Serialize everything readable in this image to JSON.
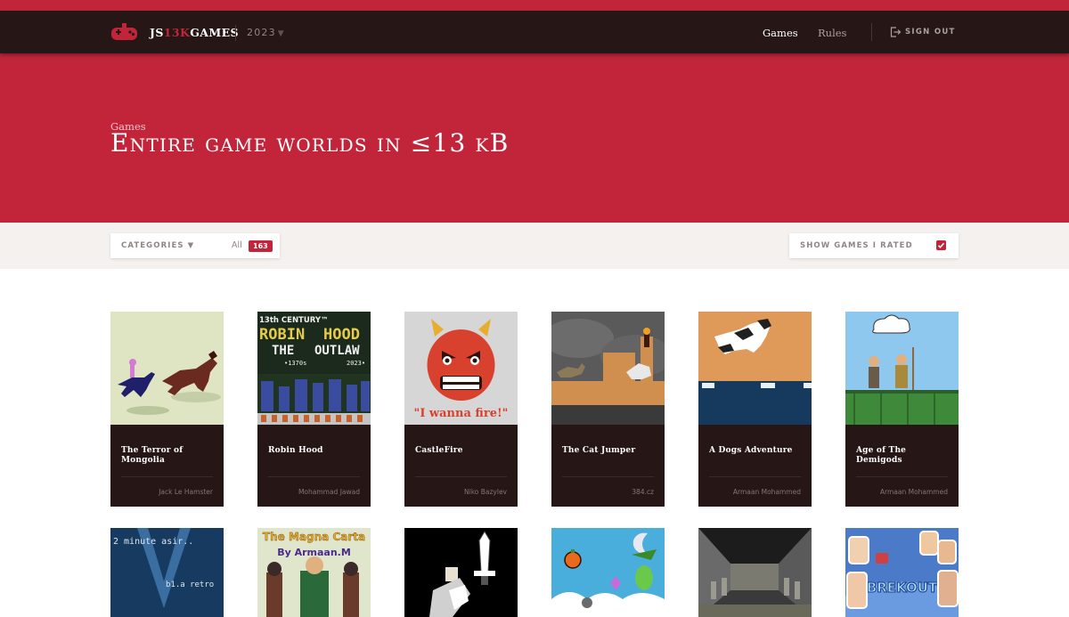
{
  "nav": {
    "brand_prefix": "JS",
    "brand_accent": "13K",
    "brand_suffix": "GAMES",
    "year": "2023",
    "games": "Games",
    "rules": "Rules",
    "sign_out": "SIGN OUT"
  },
  "hero": {
    "kicker": "Games",
    "title": "Entire game worlds in ≤13 kB"
  },
  "filters": {
    "categories_label": "CATEGORIES ▼",
    "all_label": "All",
    "count": "163",
    "rated_label": "SHOW GAMES I RATED",
    "rated_checked": true
  },
  "games": [
    {
      "title": "The Terror of Mongolia",
      "author": "Jack Le Hamster"
    },
    {
      "title": "Robin Hood",
      "author": "Mohammad Jawad"
    },
    {
      "title": "CastleFire",
      "author": "Niko Bazylev"
    },
    {
      "title": "The Cat Jumper",
      "author": "384.cz"
    },
    {
      "title": "A Dogs Adventure",
      "author": "Armaan Mohammed"
    },
    {
      "title": "Age of The Demigods",
      "author": "Armaan Mohammed"
    }
  ],
  "thumb_text": {
    "robin_line1": "13th CENTURY™",
    "robin_line2": "ROBIN",
    "robin_line3": "HOOD",
    "robin_line4": "THE",
    "robin_line5": "OUTLAW",
    "robin_line6": "•1370s",
    "robin_line7": "2023•",
    "castle_caption": "\"I wanna fire!\"",
    "row2_a": "2 minute asir..",
    "row2_a2": "b1.a retro",
    "row2_b1": "The Magna Carta",
    "row2_b2": "By Armaan.M",
    "row2_f": "BREKOUT"
  },
  "colors": {
    "brand_red": "#c2253a",
    "nav_dark": "#261616"
  },
  "icons": {
    "logo": "gamepad-icon",
    "sign_out": "sign-out-icon",
    "check": "checkbox-checked-icon"
  }
}
